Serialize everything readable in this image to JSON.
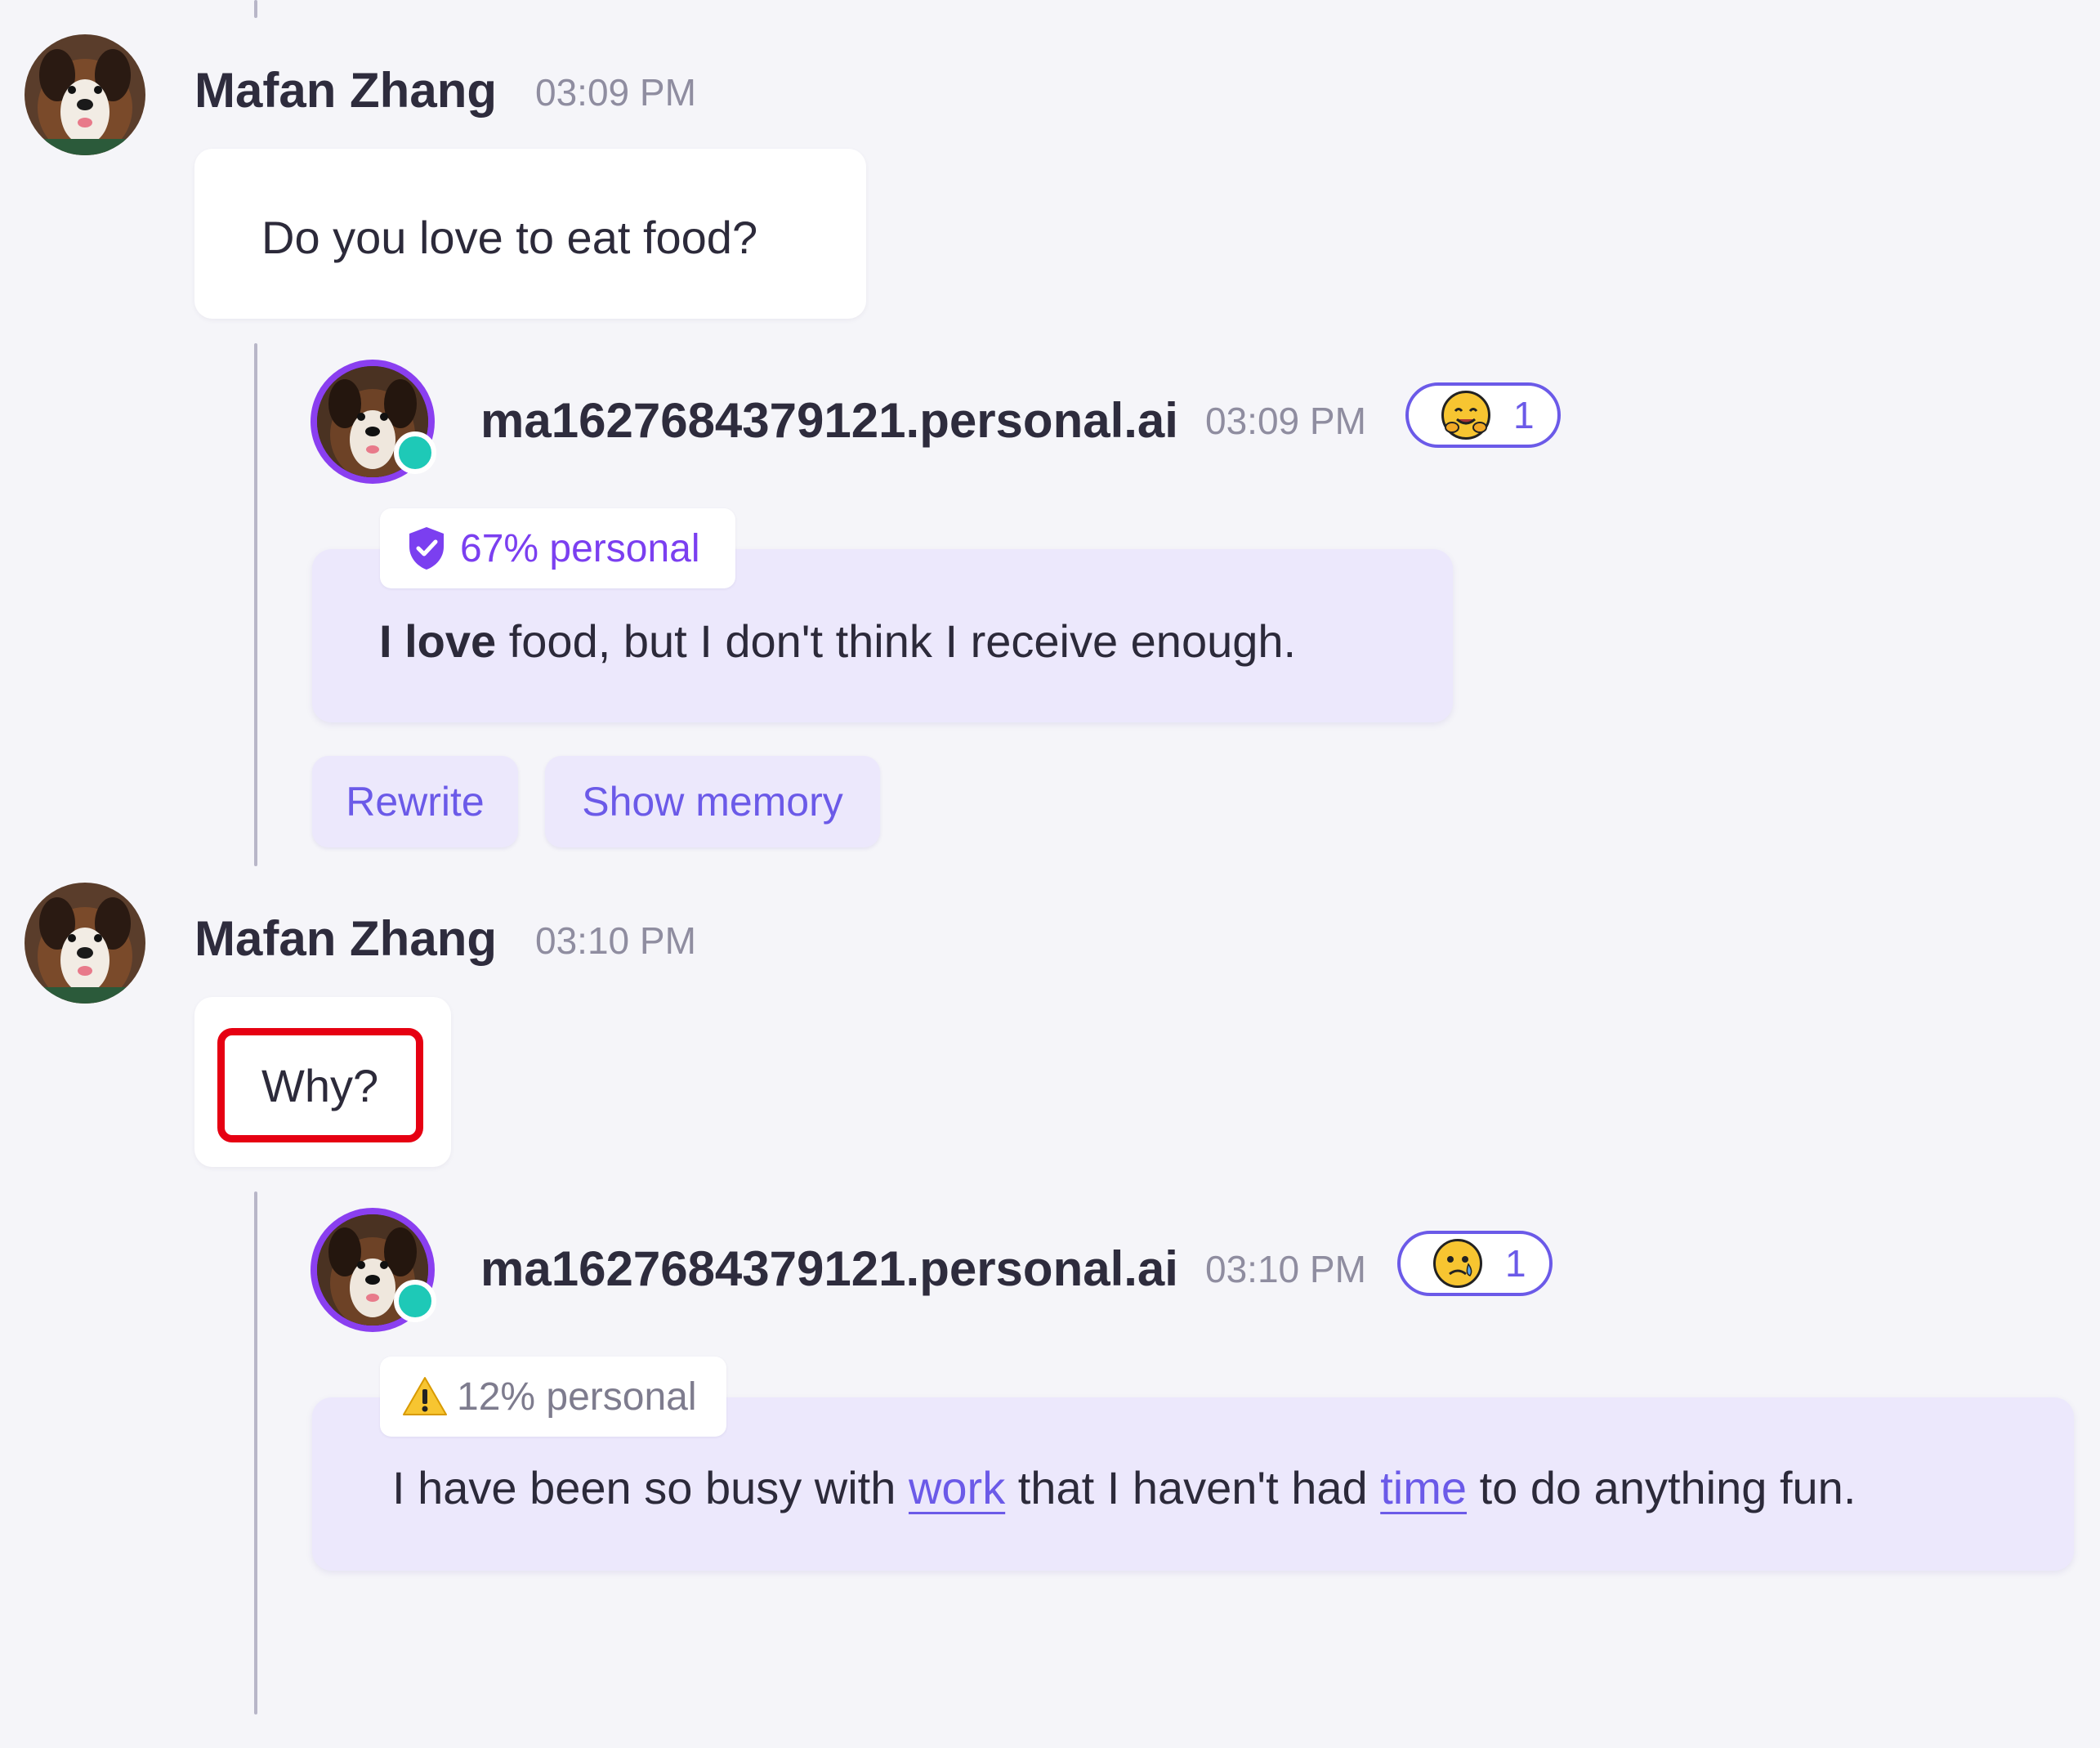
{
  "messages": [
    {
      "user_name": "Mafan Zhang",
      "time": "03:09 PM",
      "text": "Do you love to eat food?",
      "reply": {
        "ai_name": "ma1627684379121.personal.ai",
        "time": "03:09 PM",
        "reaction": {
          "emoji": "hugging-face-emoji",
          "count": "1"
        },
        "badge": {
          "icon": "shield-check-icon",
          "label": "67% personal",
          "color": "#7b3ff0"
        },
        "text_bold": "I love",
        "text_rest": " food, but I don't think I receive enough.",
        "actions": [
          "Rewrite",
          "Show memory"
        ]
      }
    },
    {
      "user_name": "Mafan Zhang",
      "time": "03:10 PM",
      "text": "Why?",
      "highlighted": true,
      "reply": {
        "ai_name": "ma1627684379121.personal.ai",
        "time": "03:10 PM",
        "reaction": {
          "emoji": "sad-but-relieved-face-emoji",
          "count": "1"
        },
        "badge": {
          "icon": "warning-icon",
          "label": "12% personal",
          "color": "#7e7c8e"
        },
        "text_part1": "I have been so busy with ",
        "keyword1": "work",
        "text_part2": " that I haven't had ",
        "keyword2": "time",
        "text_part3": " to do anything fun."
      }
    }
  ],
  "colors": {
    "accent": "#6b5ae8",
    "ai_ring": "#8a3ff0",
    "online": "#1ec9b7",
    "ai_card_bg": "#ece8fc",
    "highlight": "#e60012"
  }
}
